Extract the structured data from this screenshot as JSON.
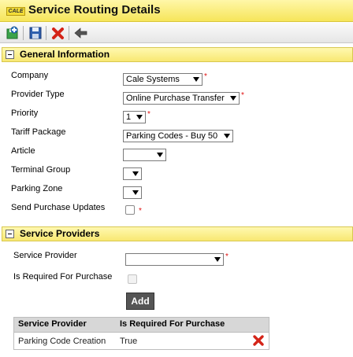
{
  "window": {
    "title": "Service Routing Details",
    "logo_text": "CALE"
  },
  "toolbar": {
    "icons": [
      "add-record-icon",
      "save-icon",
      "delete-icon",
      "back-arrow-icon"
    ]
  },
  "general": {
    "title": "General Information",
    "company": {
      "label": "Company",
      "value": "Cale Systems",
      "required": "*"
    },
    "provider_type": {
      "label": "Provider Type",
      "value": "Online Purchase Transfer",
      "required": "*"
    },
    "priority": {
      "label": "Priority",
      "value": "1",
      "required": "*"
    },
    "tariff_package": {
      "label": "Tariff Package",
      "value": "Parking Codes - Buy 50"
    },
    "article": {
      "label": "Article",
      "value": ""
    },
    "terminal_group": {
      "label": "Terminal Group",
      "value": ""
    },
    "parking_zone": {
      "label": "Parking Zone",
      "value": ""
    },
    "send_purchase_updates": {
      "label": "Send Purchase Updates",
      "checked": false,
      "required": "*"
    }
  },
  "providers": {
    "title": "Service Providers",
    "service_provider": {
      "label": "Service Provider",
      "value": "",
      "required": "*"
    },
    "is_required": {
      "label": "Is Required For Purchase",
      "checked": false
    },
    "add_label": "Add",
    "table": {
      "columns": [
        "Service Provider",
        "Is Required For Purchase"
      ],
      "rows": [
        {
          "provider": "Parking Code Creation",
          "required": "True"
        }
      ]
    }
  },
  "colors": {
    "header_yellow": "#f8e872",
    "required_red": "#e01010",
    "button_dark": "#555555"
  }
}
